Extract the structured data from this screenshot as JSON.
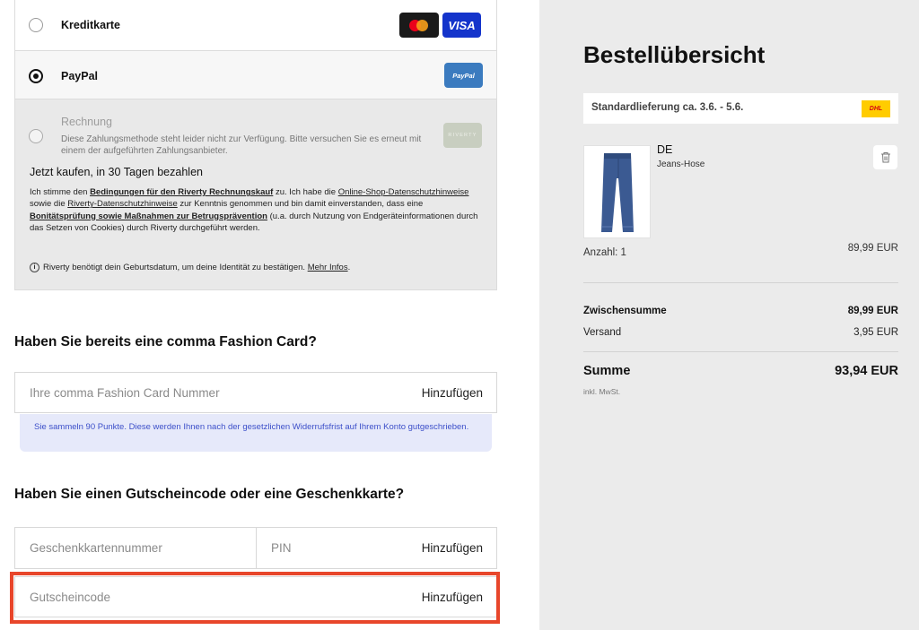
{
  "payment": {
    "kreditkarte": {
      "label": "Kreditkarte",
      "visa_label": "VISA"
    },
    "paypal": {
      "label": "PayPal",
      "logo_text": "PayPal"
    },
    "rechnung": {
      "label": "Rechnung",
      "logo_text": "RIVERTY",
      "unavailable_note": "Diese Zahlungsmethode steht leider nicht zur Verfügung. Bitte versuchen Sie es erneut mit einem der aufgeführten Zahlungsanbieter.",
      "headline": "Jetzt kaufen, in 30 Tagen bezahlen",
      "terms": {
        "t1": "Ich stimme den ",
        "link1": "Bedingungen für den Riverty Rechnungskauf",
        "t2": " zu. Ich habe die ",
        "link2": "Online-Shop-Datenschutzhinweise",
        "t3": " sowie die ",
        "link3": "Riverty-Datenschutzhinweise",
        "t4": " zur Kenntnis genommen und bin damit einverstanden, dass eine ",
        "link4": "Bonitätsprüfung sowie Maßnahmen zur Betrugsprävention",
        "t5": " (u.a. durch Nutzung von Endgeräteinformationen durch das Setzen von Cookies) durch Riverty durchgeführt werden."
      },
      "info_text": "Riverty benötigt dein Geburtsdatum, um deine Identität zu bestätigen.",
      "info_link": "Mehr Infos",
      "info_end": "."
    }
  },
  "fashion_card": {
    "title": "Haben Sie bereits eine comma Fashion Card?",
    "placeholder": "Ihre comma Fashion Card Nummer",
    "add_label": "Hinzufügen",
    "notice": "Sie sammeln 90 Punkte. Diese werden Ihnen nach der gesetzlichen Widerrufsfrist auf Ihrem Konto gutgeschrieben."
  },
  "voucher": {
    "title": "Haben Sie einen Gutscheincode oder eine Geschenkkarte?",
    "giftcard_placeholder": "Geschenkkartennummer",
    "pin_placeholder": "PIN",
    "giftcard_add_label": "Hinzufügen",
    "code_placeholder": "Gutscheincode",
    "code_add_label": "Hinzufügen"
  },
  "summary": {
    "title": "Bestellübersicht",
    "shipping": "Standardlieferung ca. 3.6. - 5.6.",
    "carrier": "DHL",
    "product": {
      "name": "DE",
      "type": "Jeans-Hose"
    },
    "quantity": "Anzahl: 1",
    "item_price": "89,99 EUR",
    "subtotal_label": "Zwischensumme",
    "subtotal_value": "89,99 EUR",
    "shipping_label": "Versand",
    "shipping_value": "3,95 EUR",
    "total_label": "Summe",
    "total_value": "93,94 EUR",
    "tax_note": "inkl. MwSt."
  },
  "colors": {
    "highlight": "#e8462b",
    "visa": "#1434cb",
    "paypal": "#3b7bbf",
    "notice_text": "#3c4fc9",
    "dhl": "#ffcc00"
  }
}
